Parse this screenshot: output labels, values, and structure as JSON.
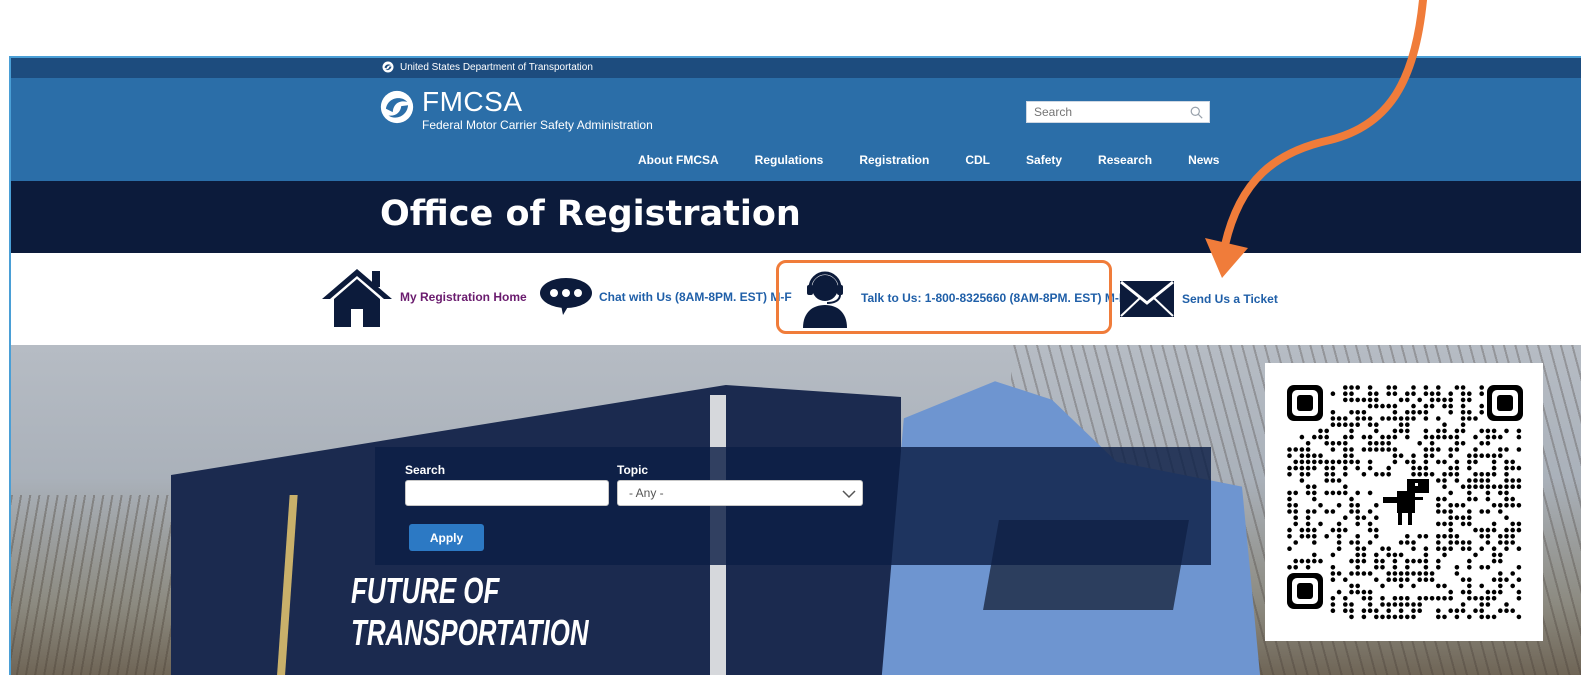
{
  "agency_bar": {
    "text": "United States Department of Transportation",
    "icon": "dot-logo-icon"
  },
  "brand": {
    "name": "FMCSA",
    "subtitle": "Federal Motor Carrier Safety Administration"
  },
  "site_search": {
    "placeholder": "Search"
  },
  "nav": {
    "items": [
      {
        "label": "About FMCSA"
      },
      {
        "label": "Regulations"
      },
      {
        "label": "Registration"
      },
      {
        "label": "CDL"
      },
      {
        "label": "Safety"
      },
      {
        "label": "Research"
      },
      {
        "label": "News"
      }
    ]
  },
  "page": {
    "title": "Office of Registration"
  },
  "quick_links": {
    "home": {
      "label": "My Registration Home",
      "icon": "house-icon"
    },
    "chat": {
      "label": "Chat with Us (8AM-8PM. EST) M-F",
      "icon": "chat-bubble-icon"
    },
    "talk": {
      "label": "Talk to Us: 1-800-8325660 (8AM-8PM. EST) M-F",
      "icon": "headset-agent-icon"
    },
    "ticket": {
      "label": "Send Us a Ticket",
      "icon": "envelope-icon"
    }
  },
  "hero": {
    "truck_text_line1": "FUTURE OF",
    "truck_text_line2": "TRANSPORTATION"
  },
  "search_panel": {
    "search_label": "Search",
    "topic_label": "Topic",
    "topic_value": "- Any -",
    "apply_label": "Apply"
  },
  "annotations": {
    "highlight_color": "#f07c3a",
    "arrow_color": "#f07c3a"
  },
  "colors": {
    "masthead": "#2b6ea8",
    "title_band": "#0c1b3b",
    "link": "#1f5fa8",
    "home_link": "#6a1b6e"
  }
}
